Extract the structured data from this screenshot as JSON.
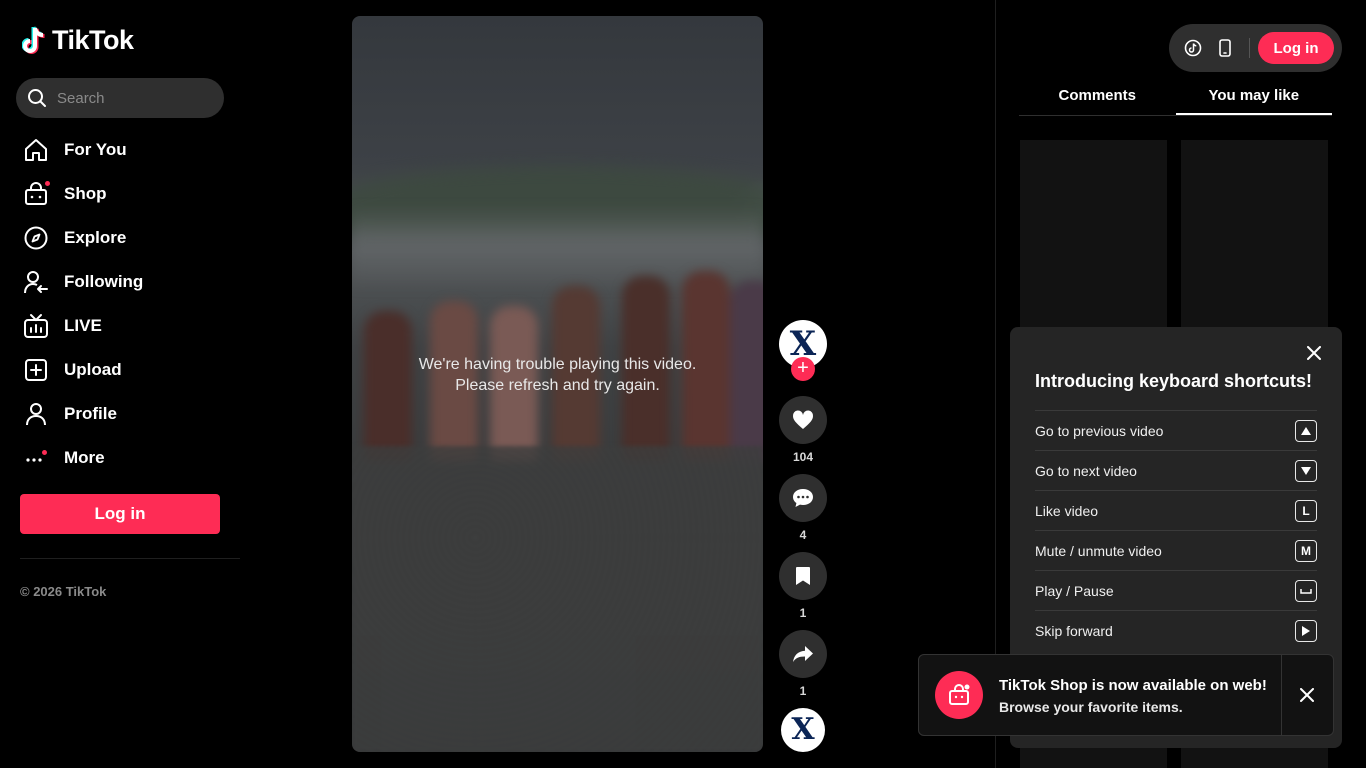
{
  "brand": {
    "name": "TikTok",
    "accent": "#fe2c55"
  },
  "search": {
    "placeholder": "Search"
  },
  "nav": {
    "items": [
      {
        "label": "For You",
        "icon": "home-icon"
      },
      {
        "label": "Shop",
        "icon": "shopping-bag-icon",
        "badge": true
      },
      {
        "label": "Explore",
        "icon": "compass-icon"
      },
      {
        "label": "Following",
        "icon": "user-follow-icon"
      },
      {
        "label": "LIVE",
        "icon": "live-tv-icon"
      },
      {
        "label": "Upload",
        "icon": "upload-plus-icon"
      },
      {
        "label": "Profile",
        "icon": "person-icon"
      },
      {
        "label": "More",
        "icon": "more-dots-icon",
        "badge": true
      }
    ]
  },
  "sidebar": {
    "login_label": "Log in",
    "copyright": "© 2026 TikTok"
  },
  "video": {
    "error_line1": "We're having trouble playing this video.",
    "error_line2": "Please refresh and try again."
  },
  "actions": {
    "author_avatar": "X",
    "follow_plus": "+",
    "likes": "104",
    "comments": "4",
    "saves": "1",
    "shares": "1"
  },
  "topbar": {
    "login_label": "Log in"
  },
  "tabs": {
    "comments": "Comments",
    "you_may_like": "You may like",
    "active": "you_may_like"
  },
  "shortcuts": {
    "title": "Introducing keyboard shortcuts!",
    "rows": [
      {
        "label": "Go to previous video",
        "key": "▲"
      },
      {
        "label": "Go to next video",
        "key": "▼"
      },
      {
        "label": "Like video",
        "key": "L"
      },
      {
        "label": "Mute / unmute video",
        "key": "M"
      },
      {
        "label": "Play / Pause",
        "key": "␣"
      },
      {
        "label": "Skip forward",
        "key": "▶"
      }
    ]
  },
  "toast": {
    "title": "TikTok Shop is now available on web!",
    "subtitle": "Browse your favorite items."
  }
}
